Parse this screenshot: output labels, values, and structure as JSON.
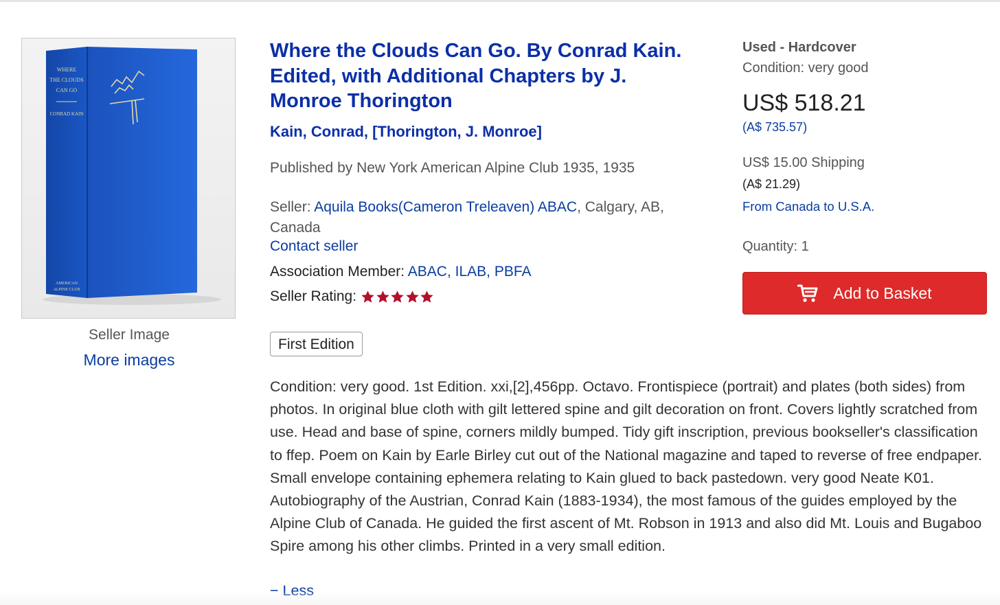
{
  "image": {
    "seller_image_label": "Seller Image",
    "more_images_link": "More images",
    "book_spine_text": {
      "title_lines": [
        "WHERE",
        "THE CLOUDS",
        "CAN GO"
      ],
      "author": "CONRAD KAIN",
      "publisher_lines": [
        "AMERICAN",
        "ALPINE CLUB"
      ]
    }
  },
  "listing": {
    "title": "Where the Clouds Can Go. By Conrad Kain. Edited, with Additional Chapters by J. Monroe Thorington",
    "author": "Kain, Conrad, [Thorington, J. Monroe]",
    "published": "Published by New York American Alpine Club 1935, 1935",
    "seller_label": "Seller: ",
    "seller_name": "Aquila Books(Cameron Treleaven) ABAC",
    "seller_location": ", Calgary, AB, Canada",
    "contact_seller": "Contact seller",
    "association_label": "Association Member: ",
    "associations": [
      "ABAC,",
      "ILAB,",
      "PBFA"
    ],
    "rating_label": "Seller Rating:",
    "rating_stars": 5,
    "edition_badge": "First Edition",
    "description": "Condition: very good. 1st Edition. xxi,[2],456pp. Octavo. Frontispiece (portrait) and plates (both sides) from photos. In original blue cloth with gilt lettered spine and gilt decoration on front. Covers lightly scratched from use. Head and base of spine, corners mildly bumped. Tidy gift inscription, previous bookseller's classification to ffep. Poem on Kain by Earle Birley cut out of the National magazine and taped to reverse of free endpaper. Small envelope containing ephemera relating to Kain glued to back pastedown. very good Neate K01. Autobiography of the Austrian, Conrad Kain (1883-1934), the most famous of the guides employed by the Alpine Club of Canada. He guided the first ascent of Mt. Robson in 1913 and also did Mt. Louis and Bugaboo Spire among his other climbs. Printed in a very small edition.",
    "less_link": "− Less"
  },
  "purchase": {
    "binding": "Used - Hardcover",
    "condition": "Condition: very good",
    "price": "US$ 518.21",
    "price_aud": "(A$ 735.57)",
    "shipping": "US$ 15.00 Shipping",
    "shipping_aud": "(A$ 21.29)",
    "shipping_route": "From Canada to U.S.A.",
    "quantity": "Quantity: 1",
    "add_to_basket": "Add to Basket"
  },
  "colors": {
    "link": "#0a3da1",
    "title": "#0b2fa8",
    "button": "#de2a2a",
    "star": "#b3102b",
    "book_cloth": "#1f5fd0"
  }
}
